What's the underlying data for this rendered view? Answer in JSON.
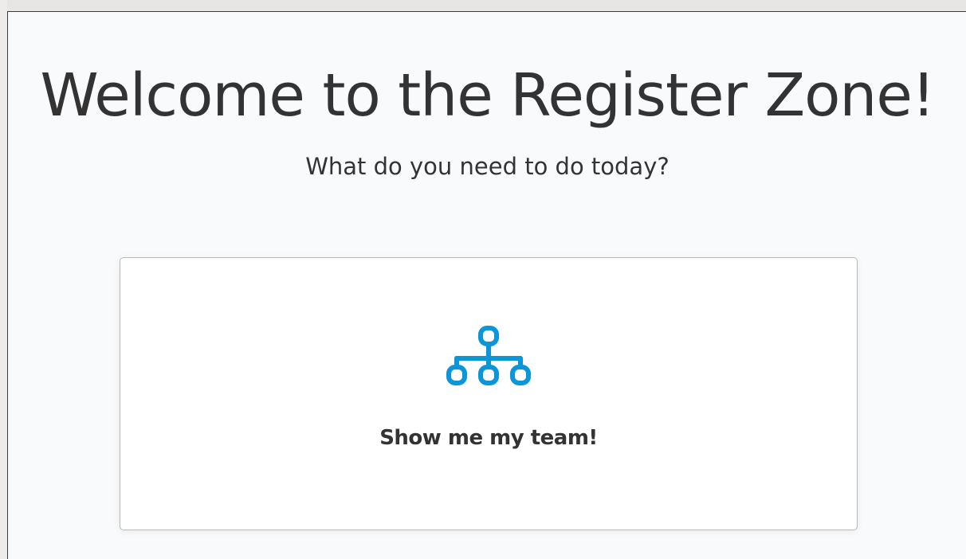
{
  "header": {
    "title": "Welcome to the Register Zone!",
    "subtitle": "What do you need to do today?"
  },
  "actions": [
    {
      "label": "Show me my team!",
      "icon": "org-chart-icon"
    }
  ],
  "colors": {
    "accent": "#0a96d8",
    "text": "#333333",
    "panel_background": "#f9fafb",
    "card_background": "#ffffff",
    "card_border": "#b9b9b9"
  }
}
